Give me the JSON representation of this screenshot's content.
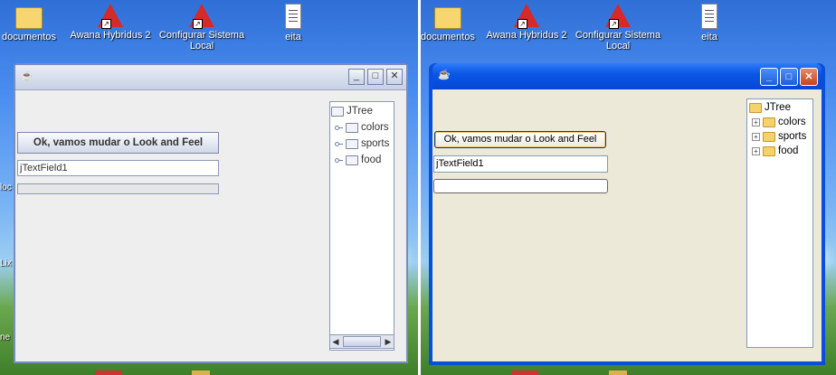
{
  "desktop_icons": {
    "documentos": "documentos",
    "awana": "Awana Hybridus 2",
    "configurar": "Configurar Sistema Local",
    "eita": "eita"
  },
  "side_labels": [
    "loc",
    "Lix",
    "ne"
  ],
  "metal": {
    "button_label": "Ok, vamos mudar o Look and Feel",
    "textfield_value": "jTextField1",
    "tree": {
      "root": "JTree",
      "children": [
        "colors",
        "sports",
        "food"
      ]
    }
  },
  "xp": {
    "button_label": "Ok, vamos mudar o Look and Feel",
    "textfield_value": "jTextField1",
    "tree": {
      "root": "JTree",
      "children": [
        "colors",
        "sports",
        "food"
      ]
    }
  },
  "colors": {
    "xp_title": "#0a57e6",
    "xp_body": "#ece9d8",
    "metal_body": "#eeeeee",
    "metal_title": "#c7d0e4"
  }
}
